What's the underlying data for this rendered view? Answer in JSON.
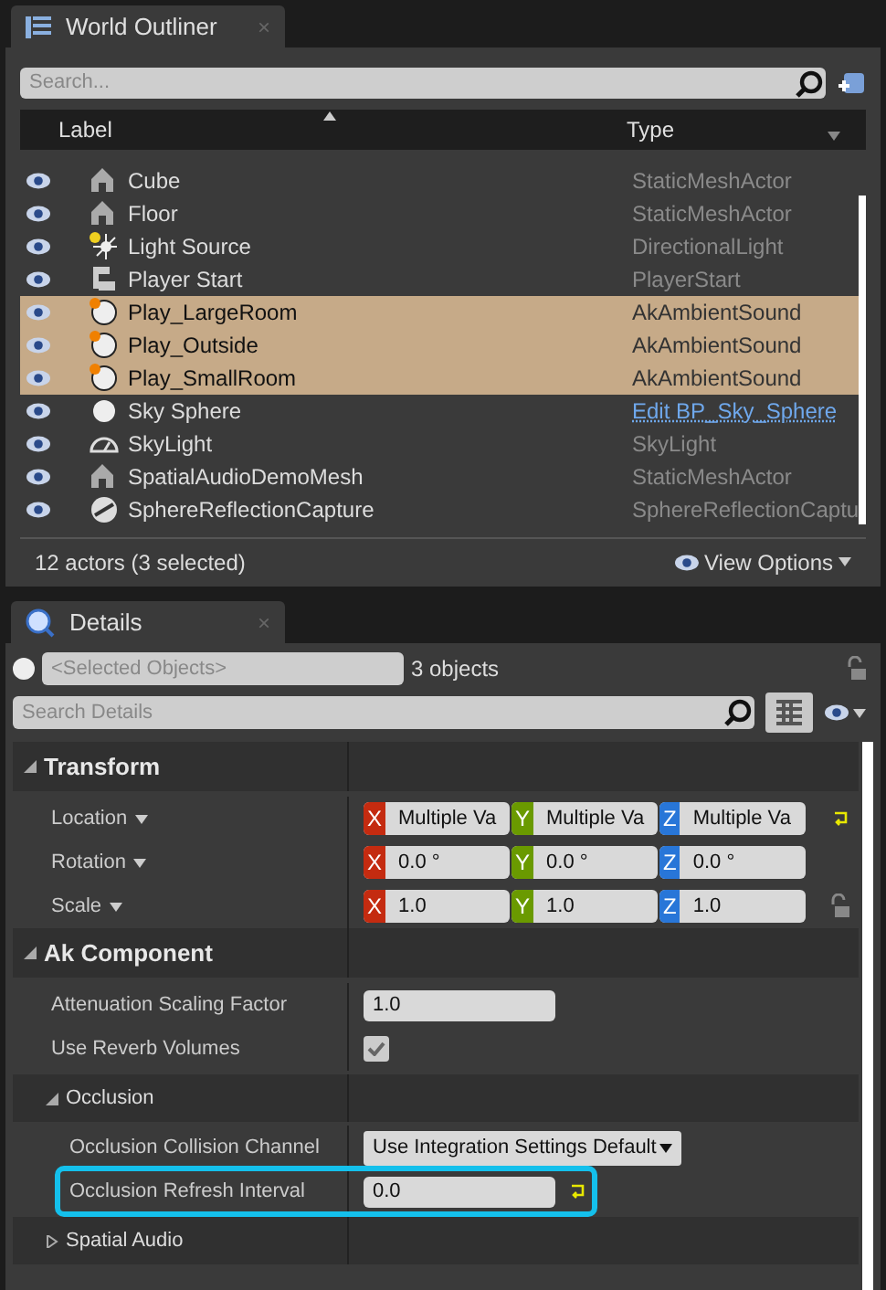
{
  "outliner": {
    "tab": {
      "title": "World Outliner",
      "close": "×"
    },
    "search": {
      "placeholder": "Search..."
    },
    "columns": [
      "Label",
      "Type"
    ],
    "rows": [
      {
        "kind": "mesh",
        "label": "Cube",
        "type": "StaticMeshActor",
        "selected": false,
        "link": false
      },
      {
        "kind": "mesh",
        "label": "Floor",
        "type": "StaticMeshActor",
        "selected": false,
        "link": false
      },
      {
        "kind": "light",
        "label": "Light Source",
        "type": "DirectionalLight",
        "selected": false,
        "link": false
      },
      {
        "kind": "start",
        "label": "Player Start",
        "type": "PlayerStart",
        "selected": false,
        "link": false
      },
      {
        "kind": "sound",
        "label": "Play_LargeRoom",
        "type": "AkAmbientSound",
        "selected": true,
        "link": false
      },
      {
        "kind": "sound",
        "label": "Play_Outside",
        "type": "AkAmbientSound",
        "selected": true,
        "link": false
      },
      {
        "kind": "sound",
        "label": "Play_SmallRoom",
        "type": "AkAmbientSound",
        "selected": true,
        "link": false
      },
      {
        "kind": "sphere",
        "label": "Sky Sphere",
        "type": "Edit BP_Sky_Sphere",
        "selected": false,
        "link": true
      },
      {
        "kind": "skylight",
        "label": "SkyLight",
        "type": "SkyLight",
        "selected": false,
        "link": false
      },
      {
        "kind": "mesh",
        "label": "SpatialAudioDemoMesh",
        "type": "StaticMeshActor",
        "selected": false,
        "link": false
      },
      {
        "kind": "capture",
        "label": "SphereReflectionCapture",
        "type": "SphereReflectionCaptu",
        "selected": false,
        "link": false
      }
    ],
    "status": "12 actors (3 selected)",
    "view_options": "View Options"
  },
  "details": {
    "tab": {
      "title": "Details",
      "close": "×"
    },
    "selected_objects": {
      "placeholder": "<Selected Objects>"
    },
    "object_count": "3 objects",
    "search": {
      "placeholder": "Search Details"
    },
    "properties": [
      {
        "kind": "category",
        "label": "Transform",
        "expanded": true
      },
      {
        "kind": "vector",
        "label": "Location",
        "values": [
          {
            "axis": "X",
            "value": "Multiple Va"
          },
          {
            "axis": "Y",
            "value": "Multiple Va"
          },
          {
            "axis": "Z",
            "value": "Multiple Va"
          }
        ],
        "reset": true,
        "lock": false
      },
      {
        "kind": "vector",
        "label": "Rotation",
        "values": [
          {
            "axis": "X",
            "value": "0.0 °"
          },
          {
            "axis": "Y",
            "value": "0.0 °"
          },
          {
            "axis": "Z",
            "value": "0.0 °"
          }
        ],
        "reset": false,
        "lock": false
      },
      {
        "kind": "vector",
        "label": "Scale",
        "values": [
          {
            "axis": "X",
            "value": "1.0"
          },
          {
            "axis": "Y",
            "value": "1.0"
          },
          {
            "axis": "Z",
            "value": "1.0"
          }
        ],
        "reset": false,
        "lock": true
      },
      {
        "kind": "category",
        "label": "Ak Component",
        "expanded": true
      },
      {
        "kind": "number",
        "label": "Attenuation Scaling Factor",
        "value": "1.0",
        "reset": false,
        "highlighted": false
      },
      {
        "kind": "checkbox",
        "label": "Use Reverb Volumes",
        "checked": true
      },
      {
        "kind": "group",
        "label": "Occlusion",
        "expanded": true
      },
      {
        "kind": "dropdown",
        "label": "Occlusion Collision Channel",
        "value": "Use Integration Settings Default"
      },
      {
        "kind": "number",
        "label": "Occlusion Refresh Interval",
        "value": "0.0",
        "reset": true,
        "highlighted": true
      },
      {
        "kind": "group",
        "label": "Spatial Audio",
        "expanded": false
      }
    ]
  }
}
